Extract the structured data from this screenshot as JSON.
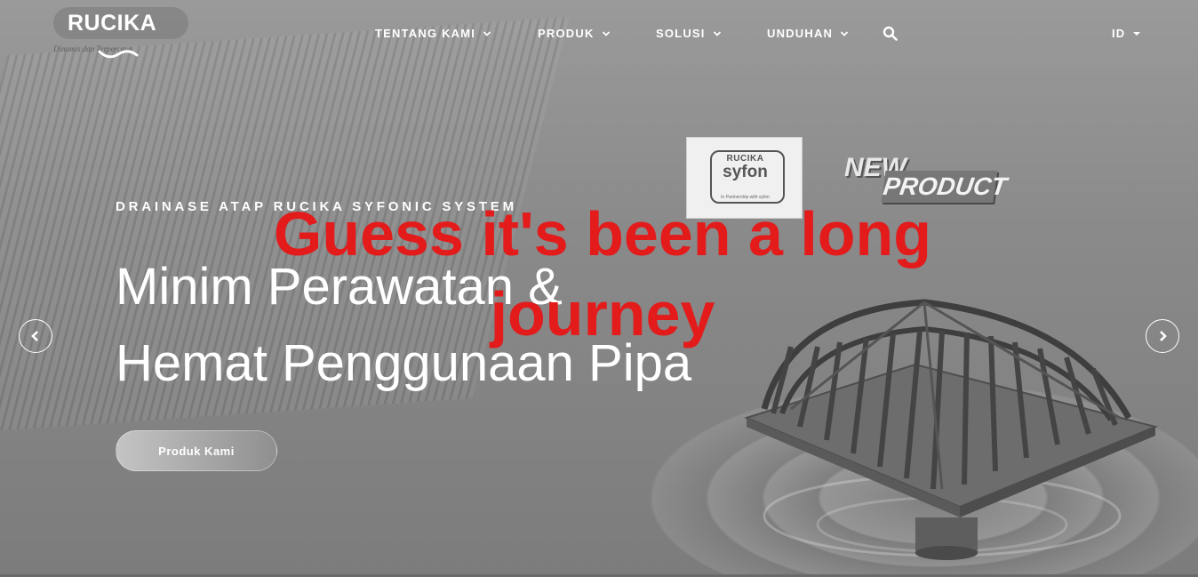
{
  "brand": {
    "logo_text": "RUCIKA",
    "tagline": "Dinamis dan Terpercaya"
  },
  "nav": {
    "items": [
      {
        "label": "TENTANG KAMI"
      },
      {
        "label": "PRODUK"
      },
      {
        "label": "SOLUSI"
      },
      {
        "label": "UNDUHAN"
      }
    ],
    "language": "ID"
  },
  "hero": {
    "kicker": "DRAINASE ATAP RUCIKA SYFONIC SYSTEM",
    "headline_line1": "Minim Perawatan &",
    "headline_line2": "Hemat Penggunaan Pipa",
    "cta_label": "Produk Kami"
  },
  "product_badge": {
    "brand": "RUCIKA",
    "product": "syfon",
    "sub": "In Partnership with syfon"
  },
  "new_tag": {
    "word1": "NEW",
    "word2": "PRODUCT"
  },
  "overlay_text": {
    "line1": "Guess it's been a long",
    "line2": "journey"
  },
  "icons": {
    "search": "search-icon",
    "prev": "chevron-left-icon",
    "next": "chevron-right-icon",
    "dropdown": "chevron-down-icon"
  },
  "colors": {
    "overlay_red": "#e31b1b",
    "text_white": "#ffffff"
  }
}
